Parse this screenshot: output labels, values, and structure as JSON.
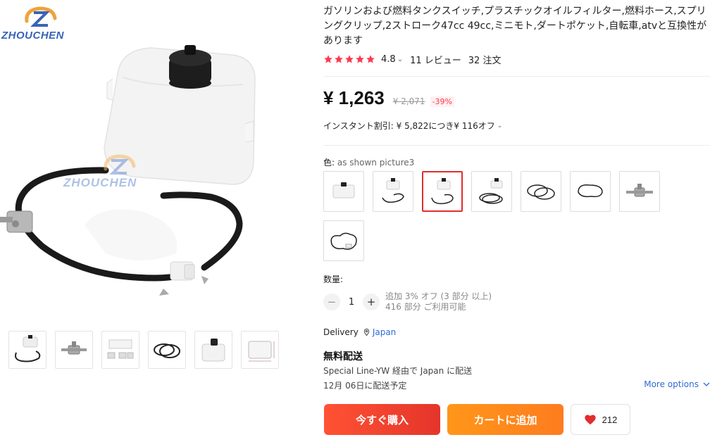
{
  "brand": {
    "logo_text": "ZHOUCHEN",
    "watermark_text": "ZHOUCHEN"
  },
  "product": {
    "title": "ガソリンおよび燃料タンクスイッチ,プラスチックオイルフィルター,燃料ホース,スプリングクリップ,2ストローク47cc 49cc,ミニモト,ダートポケット,自転車,atvと互換性があります",
    "rating": "4.8",
    "rating_caret": "⌄",
    "reviews": "11 レビュー",
    "orders": "32 注文",
    "price": "¥ 1,263",
    "price_old": "¥ 2,071",
    "discount": "-39%",
    "instant_discount": "インスタント割引: ¥ 5,822につき¥ 116オフ",
    "color_label": "色: ",
    "color_value": "as shown picture3",
    "quantity_label": "数量:",
    "quantity_value": "1",
    "quantity_note_line1": "追加 3% オフ (3 部分 以上)",
    "quantity_note_line2": "416 部分 ご利用可能",
    "delivery_label": "Delivery",
    "delivery_destination": "Japan",
    "free_shipping": "無料配送",
    "ship_via": "Special Line-YW 経由で Japan に配送",
    "ship_date": "12月 06日に配送予定",
    "more_options": "More options",
    "buy_now": "今すぐ購入",
    "add_to_cart": "カートに追加",
    "wishlist_count": "212"
  },
  "colors": {
    "accent": "#e22d2d",
    "buy": "#ff4a2f",
    "cart": "#ff8a1c",
    "star": "#fd384f",
    "link": "#2e6bd6"
  },
  "icons": {
    "star": "star-icon",
    "pin": "location-pin-icon",
    "heart": "heart-icon",
    "minus": "minus-icon",
    "plus": "plus-icon",
    "chevron": "chevron-down-icon"
  }
}
